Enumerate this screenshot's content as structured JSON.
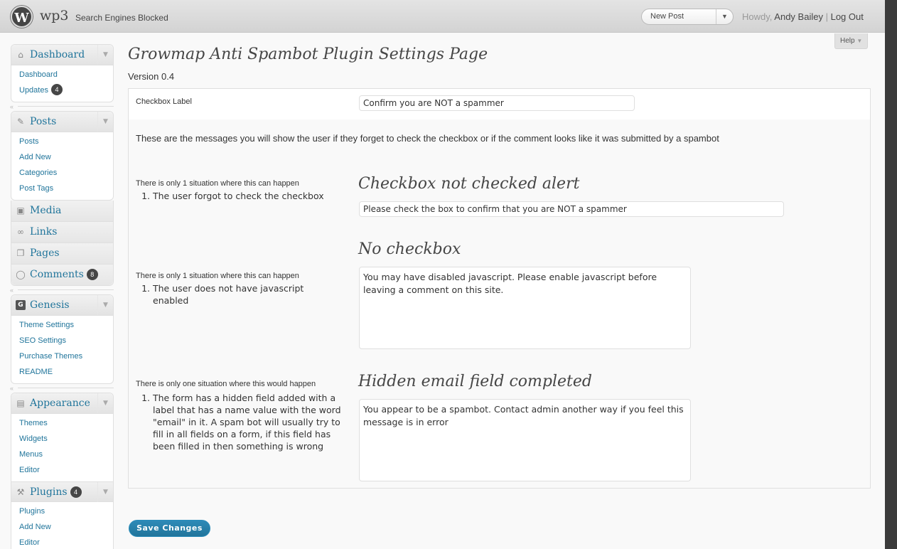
{
  "header": {
    "logo_glyph": "W",
    "site_title": "wp3",
    "site_status": "Search Engines Blocked",
    "favorite_action": "New Post",
    "howdy": "Howdy,",
    "username": "Andy Bailey",
    "separator": "|",
    "logout": "Log Out",
    "help": "Help"
  },
  "sidebar": {
    "dashboard": {
      "label": "Dashboard",
      "items": [
        "Dashboard",
        "Updates"
      ],
      "updates_count": "4"
    },
    "posts": {
      "label": "Posts",
      "items": [
        "Posts",
        "Add New",
        "Categories",
        "Post Tags"
      ]
    },
    "media": "Media",
    "links": "Links",
    "pages": "Pages",
    "comments": {
      "label": "Comments",
      "count": "8"
    },
    "genesis": {
      "label": "Genesis",
      "items": [
        "Theme Settings",
        "SEO Settings",
        "Purchase Themes",
        "README"
      ]
    },
    "appearance": {
      "label": "Appearance",
      "items": [
        "Themes",
        "Widgets",
        "Menus",
        "Editor"
      ]
    },
    "plugins": {
      "label": "Plugins",
      "count": "4",
      "items": [
        "Plugins",
        "Add New",
        "Editor"
      ]
    }
  },
  "main": {
    "title": "Growmap Anti Spambot Plugin Settings Page",
    "version": "Version 0.4",
    "checkbox_label_title": "Checkbox Label",
    "checkbox_label_value": "Confirm you are NOT a spammer",
    "intro": "These are the messages you will show the user if they forget to check the checkbox or if the comment looks like it was submitted by a spambot",
    "section1": {
      "situation": "There is only 1 situation where this can happen",
      "reason": "The user forgot to check the checkbox",
      "heading": "Checkbox not checked alert",
      "value": "Please check the box to confirm that you are NOT a spammer"
    },
    "section2": {
      "situation": "There is only 1 situation where this can happen",
      "reason": "The user does not have javascript enabled",
      "heading": "No checkbox",
      "value": "You may have disabled javascript. Please enable javascript before leaving a comment on this site."
    },
    "section3": {
      "situation": "There is only one situation where this would happen",
      "reason": "The form has a hidden field added with a label that has a name value with the word \"email\" in it. A spam bot will usually try to fill in all fields on a form, if this field has been filled in then something is wrong",
      "heading": "Hidden email field completed",
      "value": "You appear to be a spambot. Contact admin another way if you feel this message is in error"
    },
    "save_label": "Save Changes"
  }
}
